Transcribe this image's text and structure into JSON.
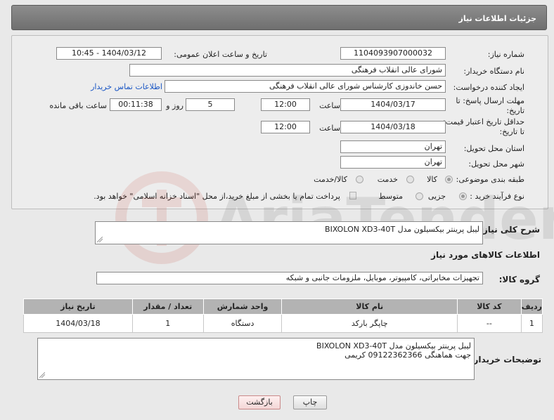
{
  "header": {
    "title": "جزئیات اطلاعات نیاز"
  },
  "form": {
    "need_number": {
      "label": "شماره نیاز:",
      "value": "1104093907000032"
    },
    "announce_datetime": {
      "label": "تاریخ و ساعت اعلان عمومی:",
      "value": "1404/03/12 - 10:45"
    },
    "buyer_org": {
      "label": "نام دستگاه خریدار:",
      "value": "شورای عالی انقلاب فرهنگی"
    },
    "requester": {
      "label": "ایجاد کننده درخواست:",
      "value": "حسن خاندوزی کارشناس شورای عالی انقلاب فرهنگی"
    },
    "buyer_contact_link": "اطلاعات تماس خریدار",
    "reply_deadline": {
      "label_line1": "مهلت ارسال پاسخ: تا",
      "label_line2": "تاریخ:",
      "date": "1404/03/17",
      "time_label": "ساعت",
      "time": "12:00",
      "days": "5",
      "days_label": "روز و",
      "remaining": "00:11:38",
      "remaining_label": "ساعت باقی مانده"
    },
    "price_validity": {
      "label_line1": "حداقل تاریخ اعتبار قیمت:",
      "label_line2": "تا تاریخ:",
      "date": "1404/03/18",
      "time_label": "ساعت",
      "time": "12:00"
    },
    "delivery_province": {
      "label": "استان محل تحویل:",
      "value": "تهران"
    },
    "delivery_city": {
      "label": "شهر محل تحویل:",
      "value": "تهران"
    },
    "category": {
      "label": "طبقه بندی موضوعی:",
      "options": [
        "کالا",
        "خدمت",
        "کالا/خدمت"
      ],
      "selected": "کالا"
    },
    "purchase_process": {
      "label": "نوع فرآیند خرید :",
      "options": [
        "جزیی",
        "متوسط"
      ],
      "selected": "جزیی",
      "payment_note": "پرداخت تمام یا بخشی از مبلغ خرید،از محل \"اسناد خزانه اسلامی\" خواهد بود."
    }
  },
  "need_summary": {
    "label": "شرح کلی نیاز:",
    "value": "لیبل پرینتر بیکسیلون مدل BIXOLON XD3-40T"
  },
  "goods_info": {
    "title": "اطلاعات کالاهای مورد نیاز"
  },
  "goods_group": {
    "label": "گروه کالا:",
    "value": "تجهیزات مخابراتی، کامپیوتر، موبایل، ملزومات جانبی و شبکه"
  },
  "items_table": {
    "headers": [
      "ردیف",
      "کد کالا",
      "نام کالا",
      "واحد شمارش",
      "تعداد / مقدار",
      "تاریخ نیاز"
    ],
    "rows": [
      [
        "1",
        "--",
        "چاپگر بارکد",
        "دستگاه",
        "1",
        "1404/03/18"
      ]
    ]
  },
  "buyer_notes": {
    "label": "توضیحات خریدار:",
    "line1": "لیبل پرینتر بیکسیلون مدل BIXOLON XD3-40T",
    "line2": "جهت هماهنگی 09122362366 کریمی"
  },
  "buttons": {
    "print": "چاپ",
    "back": "بازگشت"
  },
  "watermark": {
    "text": "AriaTender.neT"
  },
  "colors": {
    "header": "#7a7a7a",
    "link": "#1a56c4",
    "table_header": "#b3b3b3"
  }
}
